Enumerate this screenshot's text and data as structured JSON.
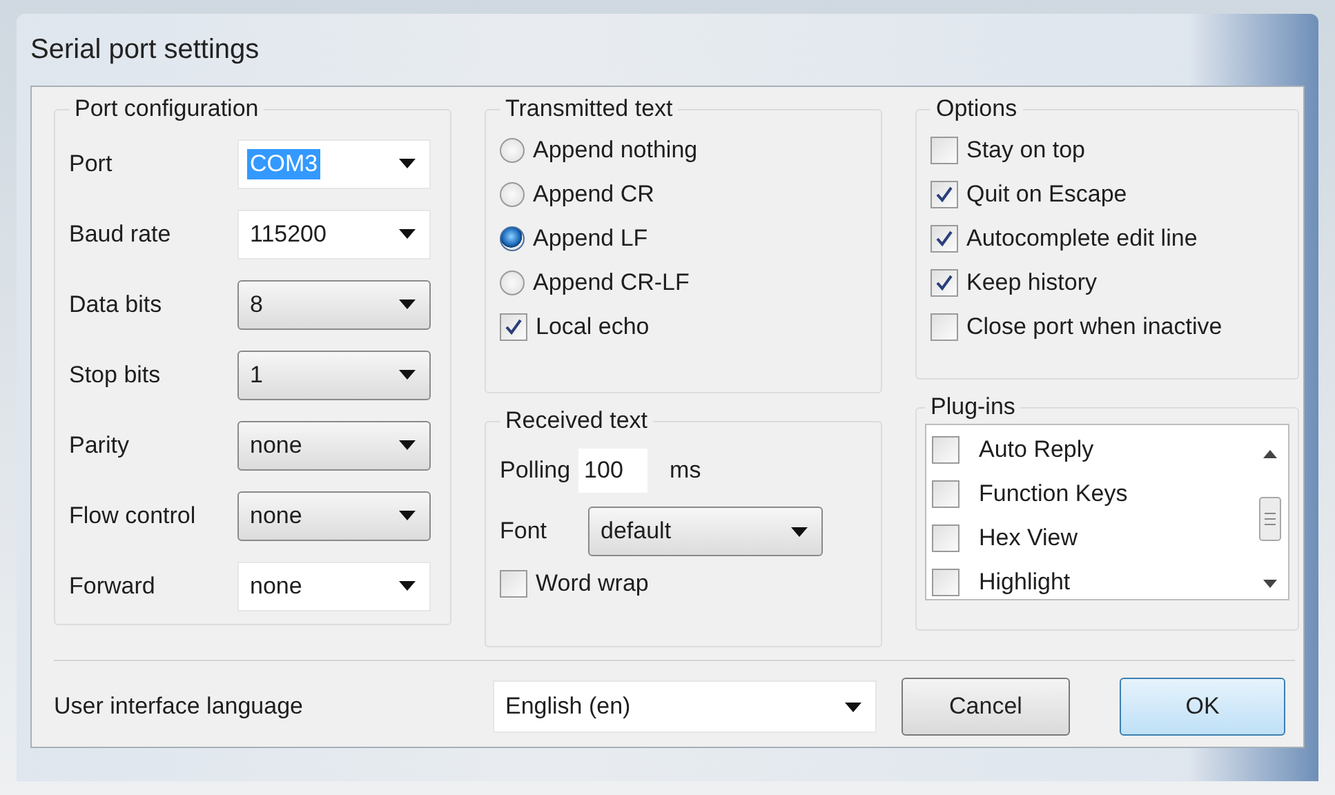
{
  "window": {
    "title": "Serial port settings"
  },
  "port_configuration": {
    "title": "Port configuration",
    "fields": [
      {
        "label": "Port",
        "value": "COM3",
        "kind": "editable",
        "highlighted": true
      },
      {
        "label": "Baud rate",
        "value": "115200",
        "kind": "editable",
        "highlighted": false
      },
      {
        "label": "Data bits",
        "value": "8",
        "kind": "list",
        "highlighted": false
      },
      {
        "label": "Stop bits",
        "value": "1",
        "kind": "list",
        "highlighted": false
      },
      {
        "label": "Parity",
        "value": "none",
        "kind": "list",
        "highlighted": false
      },
      {
        "label": "Flow control",
        "value": "none",
        "kind": "list",
        "highlighted": false
      },
      {
        "label": "Forward",
        "value": "none",
        "kind": "editable",
        "highlighted": false
      }
    ]
  },
  "transmitted_text": {
    "title": "Transmitted text",
    "options": [
      {
        "label": "Append nothing",
        "selected": false
      },
      {
        "label": "Append CR",
        "selected": false
      },
      {
        "label": "Append LF",
        "selected": true
      },
      {
        "label": "Append CR-LF",
        "selected": false
      }
    ],
    "local_echo": {
      "label": "Local echo",
      "checked": true
    }
  },
  "received_text": {
    "title": "Received text",
    "polling": {
      "label": "Polling",
      "value": "100",
      "unit": "ms"
    },
    "font": {
      "label": "Font",
      "value": "default"
    },
    "word_wrap": {
      "label": "Word wrap",
      "checked": false
    }
  },
  "options": {
    "title": "Options",
    "items": [
      {
        "label": "Stay on top",
        "checked": false
      },
      {
        "label": "Quit on Escape",
        "checked": true
      },
      {
        "label": "Autocomplete edit line",
        "checked": true
      },
      {
        "label": "Keep history",
        "checked": true
      },
      {
        "label": "Close port when inactive",
        "checked": false
      }
    ]
  },
  "plugins": {
    "title": "Plug-ins",
    "items": [
      {
        "label": "Auto Reply",
        "checked": false
      },
      {
        "label": "Function Keys",
        "checked": false
      },
      {
        "label": "Hex View",
        "checked": false
      },
      {
        "label": "Highlight",
        "checked": false
      }
    ]
  },
  "language": {
    "label": "User interface language",
    "value": "English (en)"
  },
  "buttons": [
    {
      "label": "Cancel",
      "default": false
    },
    {
      "label": "OK",
      "default": true
    }
  ]
}
